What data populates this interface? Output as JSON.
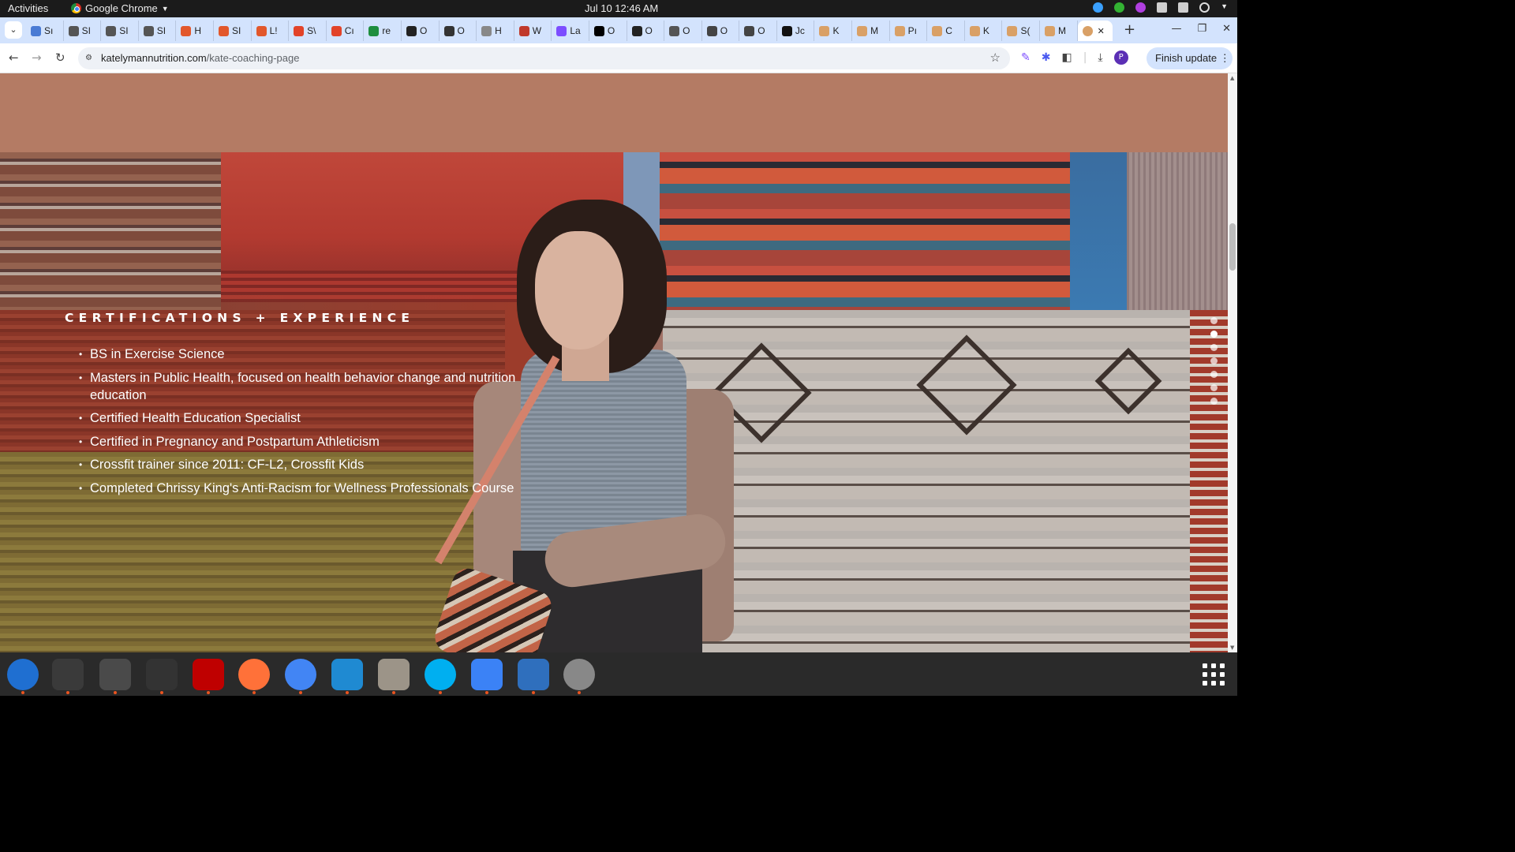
{
  "system": {
    "activities": "Activities",
    "app_name": "Google Chrome",
    "clock": "Jul 10  12:46 AM"
  },
  "tabs": [
    {
      "label": "Sı",
      "color": "#4a7bd4"
    },
    {
      "label": "SI",
      "color": "#555555"
    },
    {
      "label": "SI",
      "color": "#555555"
    },
    {
      "label": "SI",
      "color": "#555555"
    },
    {
      "label": "H",
      "color": "#e2572b"
    },
    {
      "label": "SI",
      "color": "#e2572b"
    },
    {
      "label": "L!",
      "color": "#e2572b"
    },
    {
      "label": "S\\",
      "color": "#e24329"
    },
    {
      "label": "Cı",
      "color": "#e24329"
    },
    {
      "label": "re",
      "color": "#1e8e3e"
    },
    {
      "label": "O",
      "color": "#222222"
    },
    {
      "label": "O",
      "color": "#333333"
    },
    {
      "label": "H",
      "color": "#888888"
    },
    {
      "label": "W",
      "color": "#c0392b"
    },
    {
      "label": "La",
      "color": "#7c4dff"
    },
    {
      "label": "O",
      "color": "#000000"
    },
    {
      "label": "O",
      "color": "#222222"
    },
    {
      "label": "O",
      "color": "#555555"
    },
    {
      "label": "O",
      "color": "#444444"
    },
    {
      "label": "O",
      "color": "#444444"
    },
    {
      "label": "Jc",
      "color": "#111111"
    },
    {
      "label": "K",
      "color": "#d9a066"
    },
    {
      "label": "M",
      "color": "#d9a066"
    },
    {
      "label": "Pı",
      "color": "#d9a066"
    },
    {
      "label": "C",
      "color": "#d9a066"
    },
    {
      "label": "K",
      "color": "#d9a066"
    },
    {
      "label": "S(",
      "color": "#d9a066"
    },
    {
      "label": "M",
      "color": "#d9a066"
    }
  ],
  "active_tab": {
    "color": "#d9a066",
    "close": "✕"
  },
  "toolbar": {
    "url_domain": "katelymannutrition.com",
    "url_path": "/kate-coaching-page",
    "finish_update": "Finish update",
    "profile_initial": "P"
  },
  "page": {
    "section_title": "CERTIFICATIONS + EXPERIENCE",
    "certifications": [
      "BS in Exercise Science",
      "Masters in Public Health, focused on health behavior change and nutrition education",
      "Certified Health Education Specialist",
      "Certified in Pregnancy and Postpartum Athleticism",
      "Crossfit trainer since 2011: CF-L2, Crossfit Kids",
      "Completed Chrissy King's Anti-Racism for Wellness Professionals Course"
    ],
    "slide_dots_total": 7,
    "slide_dots_active": 2
  },
  "colors": {
    "accent_band": "#b47b64",
    "tab_strip": "#d3e3fd"
  },
  "dock": {
    "apps": [
      {
        "name": "thunderbird-icon",
        "color": "#1f6fd1"
      },
      {
        "name": "terminal-icon",
        "color": "#3a3a3a"
      },
      {
        "name": "calculator-icon",
        "color": "#4a4a4a"
      },
      {
        "name": "system-monitor-icon",
        "color": "#333333"
      },
      {
        "name": "filezilla-icon",
        "color": "#bf0000"
      },
      {
        "name": "firefox-icon",
        "color": "#ff7139"
      },
      {
        "name": "chrome-icon",
        "color": "#4285f4"
      },
      {
        "name": "vscode-icon",
        "color": "#1f8ad2"
      },
      {
        "name": "files-icon",
        "color": "#9c9488"
      },
      {
        "name": "skype-icon",
        "color": "#00aff0"
      },
      {
        "name": "text-editor-icon",
        "color": "#3b82f6"
      },
      {
        "name": "document-viewer-icon",
        "color": "#2f6fbd"
      },
      {
        "name": "disc-icon",
        "color": "#888888"
      }
    ]
  }
}
